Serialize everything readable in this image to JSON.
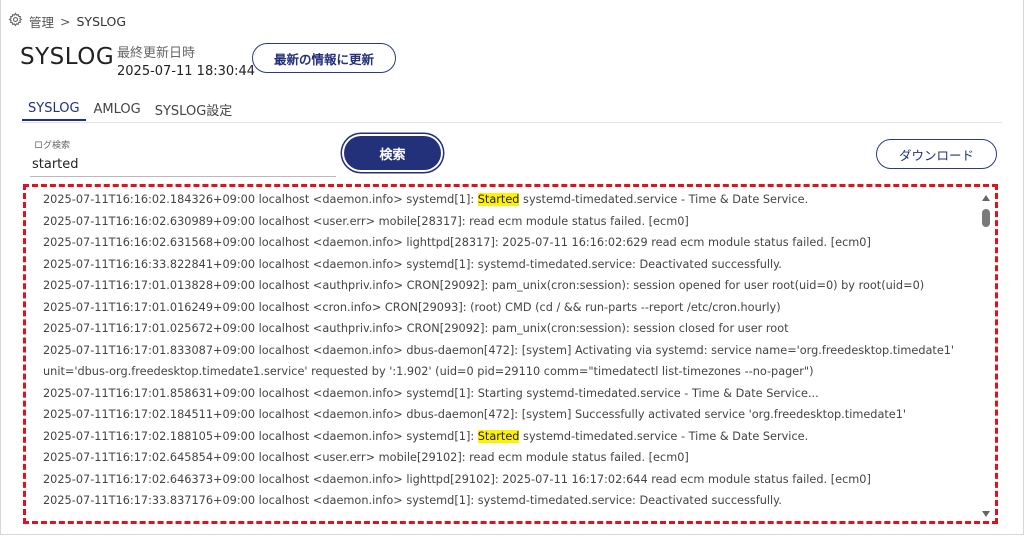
{
  "breadcrumb": {
    "parent": "管理",
    "separator": ">",
    "current": "SYSLOG"
  },
  "header": {
    "title": "SYSLOG",
    "updated_label": "最終更新日時",
    "updated_value": "2025-07-11 18:30:44",
    "refresh_label": "最新の情報に更新"
  },
  "tabs": [
    {
      "label": "SYSLOG",
      "active": true
    },
    {
      "label": "AMLOG",
      "active": false
    },
    {
      "label": "SYSLOG設定",
      "active": false
    }
  ],
  "search": {
    "label": "ログ検索",
    "value": "started",
    "button_label": "検索"
  },
  "download_label": "ダウンロード",
  "highlight_term": "Started",
  "log_lines": [
    "2025-07-11T16:16:02.184326+09:00 localhost <daemon.info> systemd[1]: Started systemd-timedated.service - Time & Date Service.",
    "2025-07-11T16:16:02.630989+09:00 localhost <user.err> mobile[28317]: read ecm module status failed. [ecm0]",
    "2025-07-11T16:16:02.631568+09:00 localhost <daemon.info> lighttpd[28317]: 2025-07-11 16:16:02:629 read ecm module status failed. [ecm0]",
    "2025-07-11T16:16:33.822841+09:00 localhost <daemon.info> systemd[1]: systemd-timedated.service: Deactivated successfully.",
    "2025-07-11T16:17:01.013828+09:00 localhost <authpriv.info> CRON[29092]: pam_unix(cron:session): session opened for user root(uid=0) by root(uid=0)",
    "2025-07-11T16:17:01.016249+09:00 localhost <cron.info> CRON[29093]: (root) CMD (cd / && run-parts --report /etc/cron.hourly)",
    "2025-07-11T16:17:01.025672+09:00 localhost <authpriv.info> CRON[29092]: pam_unix(cron:session): session closed for user root",
    "2025-07-11T16:17:01.833087+09:00 localhost <daemon.info> dbus-daemon[472]: [system] Activating via systemd: service name='org.freedesktop.timedate1'",
    "unit='dbus-org.freedesktop.timedate1.service' requested by ':1.902' (uid=0 pid=29110 comm=\"timedatectl list-timezones --no-pager\")",
    "2025-07-11T16:17:01.858631+09:00 localhost <daemon.info> systemd[1]: Starting systemd-timedated.service - Time & Date Service...",
    "2025-07-11T16:17:02.184511+09:00 localhost <daemon.info> dbus-daemon[472]: [system] Successfully activated service 'org.freedesktop.timedate1'",
    "2025-07-11T16:17:02.188105+09:00 localhost <daemon.info> systemd[1]: Started systemd-timedated.service - Time & Date Service.",
    "2025-07-11T16:17:02.645854+09:00 localhost <user.err> mobile[29102]: read ecm module status failed. [ecm0]",
    "2025-07-11T16:17:02.646373+09:00 localhost <daemon.info> lighttpd[29102]: 2025-07-11 16:17:02:644 read ecm module status failed. [ecm0]",
    "2025-07-11T16:17:33.837176+09:00 localhost <daemon.info> systemd[1]: systemd-timedated.service: Deactivated successfully."
  ],
  "colors": {
    "accent": "#23307a",
    "highlight": "#fff200",
    "outline": "#e0121e"
  }
}
